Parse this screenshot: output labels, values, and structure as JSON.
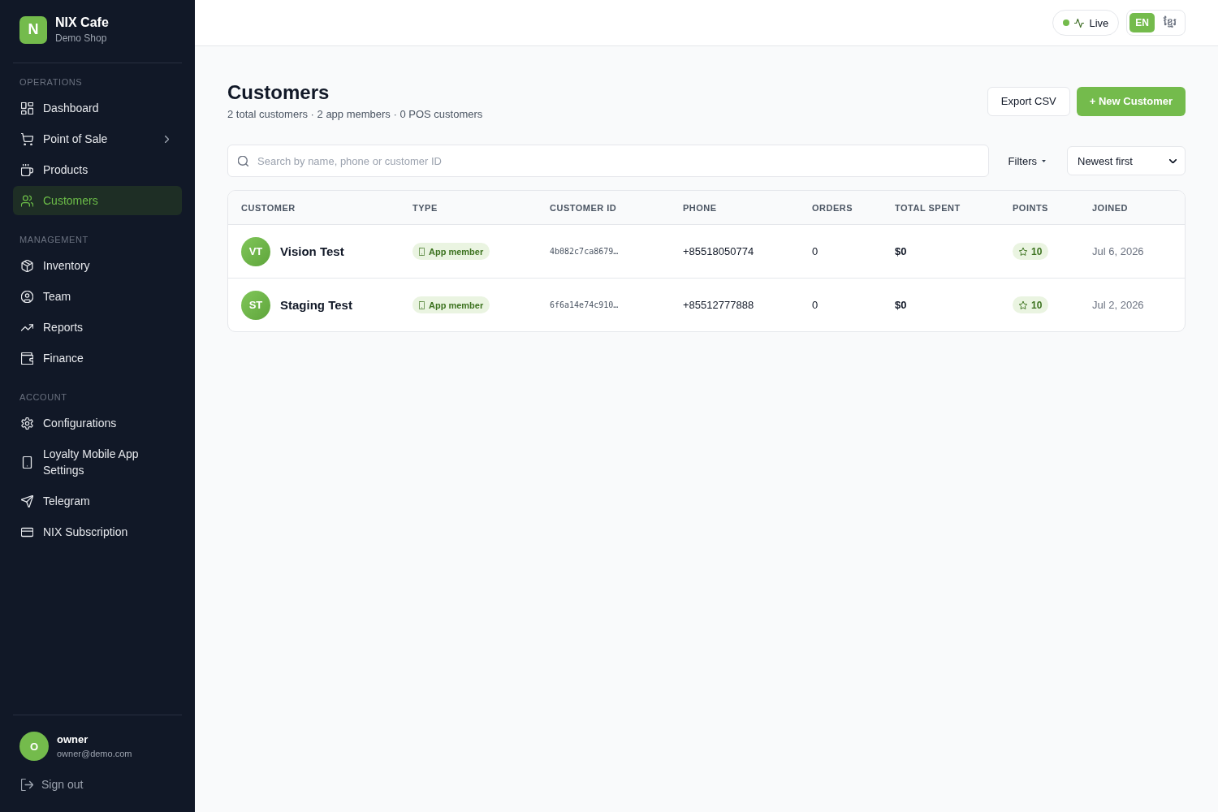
{
  "sidebar": {
    "brand": {
      "logo": "N",
      "name": "NIX Cafe",
      "subtitle": "Demo Shop"
    },
    "sections": [
      {
        "heading": "OPERATIONS",
        "items": [
          {
            "label": "Dashboard",
            "selected": false,
            "has_submenu": false
          },
          {
            "label": "Point of Sale",
            "selected": false,
            "has_submenu": true
          },
          {
            "label": "Products",
            "selected": false,
            "has_submenu": false
          },
          {
            "label": "Customers",
            "selected": true,
            "has_submenu": false
          }
        ]
      },
      {
        "heading": "MANAGEMENT",
        "items": [
          {
            "label": "Inventory",
            "selected": false,
            "has_submenu": false
          },
          {
            "label": "Team",
            "selected": false,
            "has_submenu": false
          },
          {
            "label": "Reports",
            "selected": false,
            "has_submenu": false
          },
          {
            "label": "Finance",
            "selected": false,
            "has_submenu": false
          }
        ]
      },
      {
        "heading": "ACCOUNT",
        "items": [
          {
            "label": "Configurations",
            "selected": false,
            "has_submenu": false
          },
          {
            "label": "Loyalty Mobile App Settings",
            "selected": false,
            "has_submenu": false
          },
          {
            "label": "Telegram",
            "selected": false,
            "has_submenu": false
          },
          {
            "label": "NIX Subscription",
            "selected": false,
            "has_submenu": false
          }
        ]
      }
    ],
    "user": {
      "initial": "O",
      "name": "owner",
      "email": "owner@demo.com"
    },
    "sign_out": "Sign out"
  },
  "topbar": {
    "status": {
      "label": "Live",
      "online": true
    },
    "languages": [
      {
        "label": "EN",
        "selected": true
      },
      {
        "label": "ខ្មែរ",
        "selected": false
      }
    ]
  },
  "page": {
    "title": "Customers",
    "summary": "2 total customers · 2 app members · 0 POS customers",
    "actions": [
      {
        "label": "Export CSV",
        "kind": "secondary"
      },
      {
        "label": "+ New Customer",
        "kind": "primary"
      }
    ]
  },
  "toolbar": {
    "search": {
      "placeholder": "Search by name, phone or customer ID"
    },
    "filters": "Filters",
    "sort": "Newest first"
  },
  "table": {
    "columns": [
      "CUSTOMER",
      "TYPE",
      "CUSTOMER ID",
      "PHONE",
      "ORDERS",
      "TOTAL SPENT",
      "POINTS",
      "JOINED"
    ],
    "rows": [
      {
        "initials": "VT",
        "name": "Vision Test",
        "type": "App member",
        "customer_id": "4b082c7ca8679…",
        "phone": "+85518050774",
        "orders": "0",
        "total_spent": "$0",
        "points": "10",
        "joined": "Jul 6, 2026"
      },
      {
        "initials": "ST",
        "name": "Staging Test",
        "type": "App member",
        "customer_id": "6f6a14e74c910…",
        "phone": "+85512777888",
        "orders": "0",
        "total_spent": "$0",
        "points": "10",
        "joined": "Jul 2, 2026"
      }
    ]
  }
}
